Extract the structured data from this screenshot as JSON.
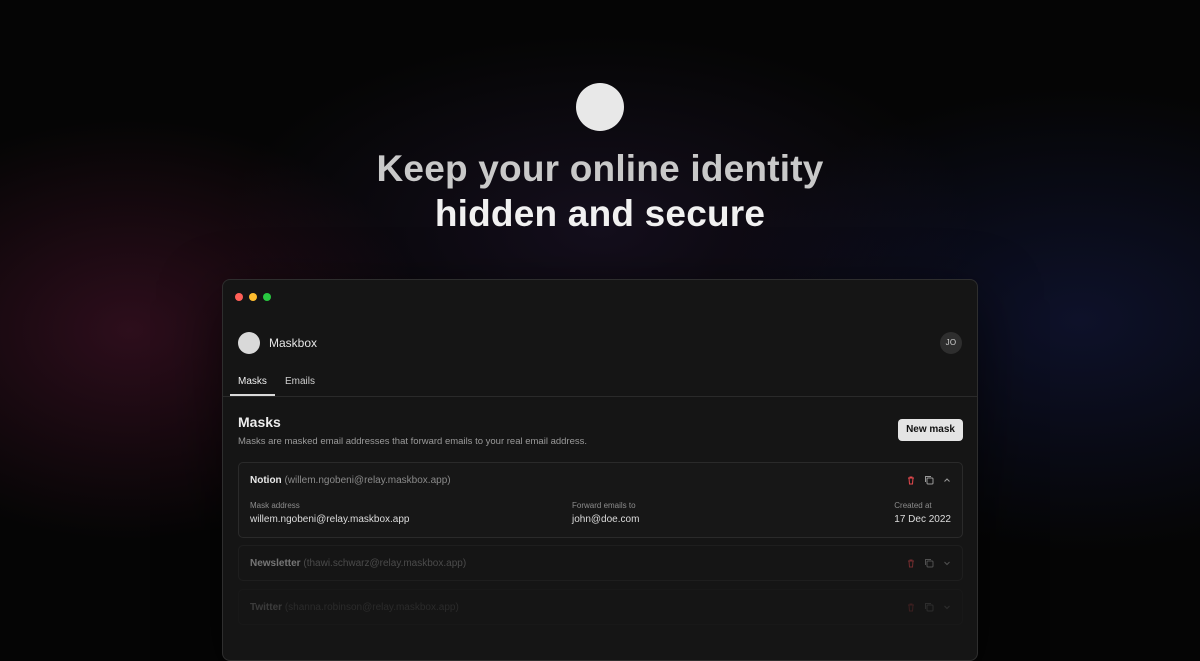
{
  "hero": {
    "headline_line1": "Keep your online identity",
    "headline_line2": "hidden and secure"
  },
  "window": {
    "controls": [
      "close",
      "minimize",
      "maximize"
    ]
  },
  "app": {
    "name": "Maskbox",
    "user_initials": "JO"
  },
  "tabs": [
    {
      "label": "Masks",
      "active": true
    },
    {
      "label": "Emails",
      "active": false
    }
  ],
  "section": {
    "title": "Masks",
    "description": "Masks are masked email addresses that forward emails to your real email address.",
    "new_button_label": "New mask"
  },
  "masks": [
    {
      "name": "Notion",
      "address_paren": "(willem.ngobeni@relay.maskbox.app)",
      "expanded": true,
      "mask_address_label": "Mask address",
      "mask_address": "willem.ngobeni@relay.maskbox.app",
      "forward_label": "Forward emails to",
      "forward_to": "john@doe.com",
      "created_label": "Created at",
      "created_at": "17 Dec 2022"
    },
    {
      "name": "Newsletter",
      "address_paren": "(thawi.schwarz@relay.maskbox.app)",
      "expanded": false
    },
    {
      "name": "Twitter",
      "address_paren": "(shanna.robinson@relay.maskbox.app)",
      "expanded": false
    }
  ],
  "icons": {
    "delete": "trash-icon",
    "copy": "copy-icon",
    "collapse": "chevron-up-icon",
    "expand": "chevron-down-icon"
  },
  "colors": {
    "delete_icon": "#e5484d",
    "traffic_red": "#ff5f57",
    "traffic_yellow": "#febc2e",
    "traffic_green": "#28c840"
  }
}
